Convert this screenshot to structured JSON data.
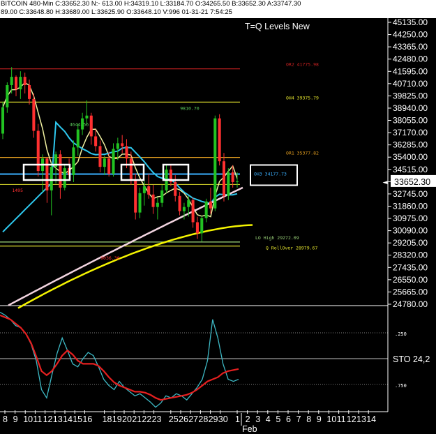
{
  "header": {
    "line1": "BITCOIN  480-Min  C:33652.30  N:- 613.00  H:34319.10  L:33184.70  O:34265.50  B:33652.30  A:33747.30",
    "line2": "89.00  C:33648.80  H:33689.00  L:33625.90  O:33648.10  V:996  01-31-21  7:54:25"
  },
  "chart_data": {
    "type": "candlestick",
    "title": "T=Q Levels New",
    "price_axis": {
      "min": 24780,
      "max": 45135,
      "ticks": [
        "45135.00",
        "44250.00",
        "43365.00",
        "42480.00",
        "41595.00",
        "40710.00",
        "39825.00",
        "38940.00",
        "38055.00",
        "37170.00",
        "36285.00",
        "35400.00",
        "34515.00",
        "33630.00",
        "32745.00",
        "31860.00",
        "30975.00",
        "30090.00",
        "29205.00",
        "28320.00",
        "27435.00",
        "26550.00",
        "25665.00",
        "24780.00"
      ],
      "last_price": "33652.30"
    },
    "date_axis": {
      "labels": [
        "8",
        "9",
        "10",
        "11",
        "12",
        "13",
        "14",
        "15",
        "16",
        "18",
        "19",
        "20",
        "21",
        "22",
        "23",
        "25",
        "26",
        "27",
        "28",
        "29",
        "30",
        "1",
        "2",
        "3",
        "4",
        "5",
        "6",
        "7",
        "8",
        "9",
        "10",
        "11",
        "12",
        "13",
        "14"
      ],
      "month_label": "Feb"
    },
    "levels": [
      {
        "label": "OR2 41775.98",
        "price": 41776,
        "color": "#cc2222"
      },
      {
        "label": "OH4 39375.79",
        "price": 39376,
        "color": "#e6e62e"
      },
      {
        "label": "OR1 35377.82",
        "price": 35378,
        "color": "#e6a020"
      },
      {
        "label": "OH3 34177.73",
        "price": 34178,
        "color": "#3ab0ff"
      },
      {
        "label": "LO High 29272.09",
        "price": 29272,
        "color": "#9bd27a"
      },
      {
        "label": "Q RollOver 28979.67",
        "price": 28980,
        "color": "#e6e62e"
      }
    ],
    "annotations": [
      {
        "text": "4644.56",
        "price": 37650,
        "index": 17,
        "color": "#5ecb5e"
      },
      {
        "text": "9810.70",
        "price": 38800,
        "index": 42,
        "color": "#5ecb5e"
      },
      {
        "text": "9036.30",
        "price": 28000,
        "index": 24,
        "color": "#ff3030"
      },
      {
        "text": "1495",
        "price": 32900,
        "index": 4,
        "color": "#ff3030"
      }
    ],
    "candles": [
      [
        37100,
        39400,
        36700,
        39000
      ],
      [
        39000,
        40800,
        38600,
        40600
      ],
      [
        40600,
        41900,
        40000,
        41200
      ],
      [
        41200,
        41300,
        39800,
        40300
      ],
      [
        40300,
        41600,
        39600,
        41200
      ],
      [
        41200,
        41500,
        40000,
        40600
      ],
      [
        40600,
        41000,
        39200,
        39600
      ],
      [
        39600,
        40000,
        36800,
        37300
      ],
      [
        37300,
        37800,
        34000,
        34400
      ],
      [
        34400,
        35600,
        32900,
        35300
      ],
      [
        35300,
        35400,
        32100,
        33000
      ],
      [
        33000,
        35000,
        31200,
        34700
      ],
      [
        34700,
        35800,
        33500,
        35600
      ],
      [
        35600,
        35900,
        32400,
        33200
      ],
      [
        33200,
        34900,
        33000,
        34600
      ],
      [
        34600,
        35300,
        33800,
        34100
      ],
      [
        34100,
        36600,
        33600,
        36100
      ],
      [
        36100,
        37800,
        35500,
        37400
      ],
      [
        37400,
        38600,
        37000,
        38200
      ],
      [
        38200,
        39500,
        37700,
        38400
      ],
      [
        38400,
        38600,
        36300,
        36900
      ],
      [
        36900,
        37400,
        35800,
        36200
      ],
      [
        36200,
        36600,
        34300,
        34700
      ],
      [
        34700,
        35500,
        34100,
        35300
      ],
      [
        35300,
        35800,
        34000,
        34200
      ],
      [
        34200,
        36400,
        34000,
        36000
      ],
      [
        36000,
        36800,
        35200,
        36400
      ],
      [
        36400,
        37000,
        35700,
        36200
      ],
      [
        36200,
        36700,
        34600,
        35300
      ],
      [
        35300,
        35800,
        33400,
        33800
      ],
      [
        33800,
        34200,
        30900,
        31400
      ],
      [
        31400,
        33200,
        31000,
        32800
      ],
      [
        32800,
        33700,
        31900,
        33300
      ],
      [
        33300,
        34200,
        32400,
        32700
      ],
      [
        32700,
        33400,
        31300,
        31800
      ],
      [
        31800,
        32500,
        30900,
        32100
      ],
      [
        32100,
        33400,
        31800,
        33000
      ],
      [
        33000,
        34900,
        32800,
        34500
      ],
      [
        34500,
        34900,
        33300,
        33600
      ],
      [
        33600,
        34100,
        32200,
        32600
      ],
      [
        32600,
        32900,
        31200,
        31500
      ],
      [
        31500,
        32100,
        30900,
        31800
      ],
      [
        31800,
        32600,
        31100,
        32300
      ],
      [
        32300,
        32500,
        30300,
        30700
      ],
      [
        30700,
        31100,
        29500,
        29900
      ],
      [
        29900,
        31200,
        29300,
        31000
      ],
      [
        31000,
        32400,
        30700,
        32200
      ],
      [
        32200,
        33200,
        31300,
        31700
      ],
      [
        31700,
        38400,
        31500,
        38200
      ],
      [
        38200,
        38500,
        34800,
        35100
      ],
      [
        35100,
        35700,
        32200,
        32600
      ],
      [
        32600,
        34600,
        32300,
        34300
      ],
      [
        34300,
        34800,
        33200,
        33600
      ],
      [
        33600,
        34300,
        33200,
        33650
      ]
    ],
    "stochastic": {
      "label": "STO 24,2",
      "levels": [
        ".250",
        ".750"
      ],
      "k": [
        0.05,
        0.08,
        0.12,
        0.18,
        0.2,
        0.26,
        0.36,
        0.52,
        0.8,
        0.88,
        0.66,
        0.45,
        0.3,
        0.42,
        0.55,
        0.58,
        0.5,
        0.44,
        0.47,
        0.58,
        0.7,
        0.76,
        0.8,
        0.72,
        0.78,
        0.82,
        0.86,
        0.84,
        0.88,
        0.92,
        0.97,
        0.93,
        0.86,
        0.88,
        0.84,
        0.86,
        0.9,
        0.84,
        0.78,
        0.7,
        0.52,
        0.12,
        0.3,
        0.55,
        0.7,
        0.72,
        0.7
      ],
      "d": [
        0.08,
        0.1,
        0.12,
        0.16,
        0.2,
        0.26,
        0.35,
        0.48,
        0.62,
        0.66,
        0.62,
        0.55,
        0.47,
        0.42,
        0.46,
        0.52,
        0.55,
        0.55,
        0.55,
        0.57,
        0.62,
        0.68,
        0.73,
        0.76,
        0.78,
        0.8,
        0.82,
        0.82,
        0.83,
        0.85,
        0.88,
        0.9,
        0.89,
        0.88,
        0.87,
        0.86,
        0.85,
        0.83,
        0.8,
        0.76,
        0.72,
        0.7,
        0.68,
        0.64,
        0.62,
        0.61,
        0.6
      ]
    },
    "colors": {
      "background": "#000000",
      "bull": "#22c322",
      "bear": "#ff3030",
      "ma_fast": "#f0f0a0",
      "ma_cyan": "#2ec8ee",
      "ma_pink": "#f2d4e0",
      "ma_yellow": "#f4f400",
      "k_line": "#3db8c4",
      "d_line": "#e62020",
      "grid": "#ffffff"
    }
  },
  "chart_title": "T=Q Levels New"
}
